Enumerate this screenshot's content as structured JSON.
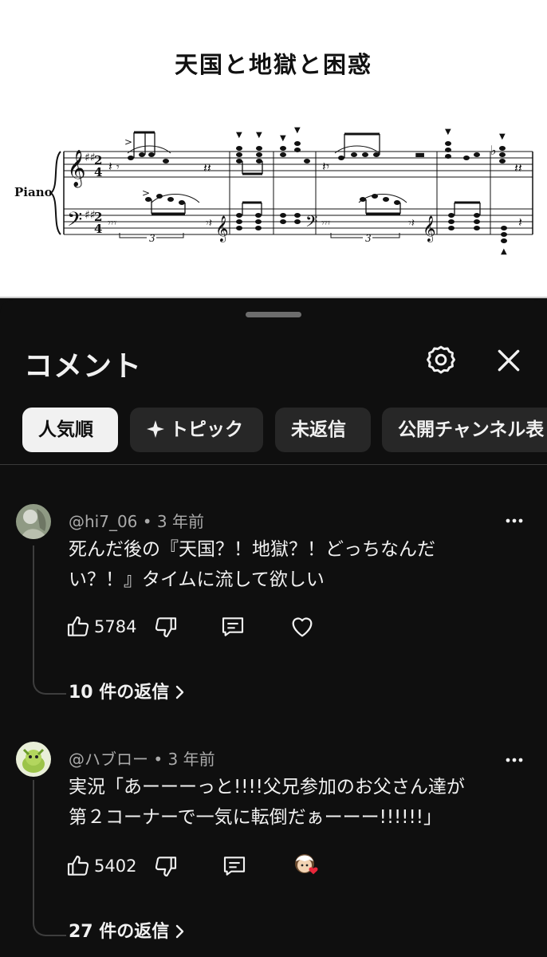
{
  "video": {
    "score_title": "天国と地獄と困惑",
    "instrument_label": "Piano",
    "tuplet_label": "3"
  },
  "comments_sheet": {
    "title": "コメント",
    "chips": [
      {
        "label": "人気順",
        "active": true
      },
      {
        "label": "トピック",
        "icon": "sparkle-icon",
        "active": false
      },
      {
        "label": "未返信",
        "active": false
      },
      {
        "label": "公開チャンネル表",
        "active": false
      }
    ],
    "comments": [
      {
        "author": "@hi7_06",
        "age": "3 年前",
        "text_lines": [
          "死んだ後の『天国？！地獄？！どっちなんだ",
          "い？！』タイムに流して欲しい"
        ],
        "likes": "5784",
        "replies": "10 件の返信",
        "creator_heart": false
      },
      {
        "author": "@ハブロー",
        "age": "3 年前",
        "text_lines": [
          "実況「あーーーっと!!!!父兄参加のお父さん達が",
          "第２コーナーで一気に転倒だぁーーー!!!!!!」"
        ],
        "likes": "5402",
        "replies": "27 件の返信",
        "creator_heart": true
      }
    ]
  },
  "colors": {
    "background": "#0f0f0f",
    "chip_bg": "#272727",
    "chip_active_bg": "#f1f1f1",
    "text_primary": "#f1f1f1",
    "text_secondary": "#aaaaaa",
    "heart_red": "#e8273a"
  }
}
